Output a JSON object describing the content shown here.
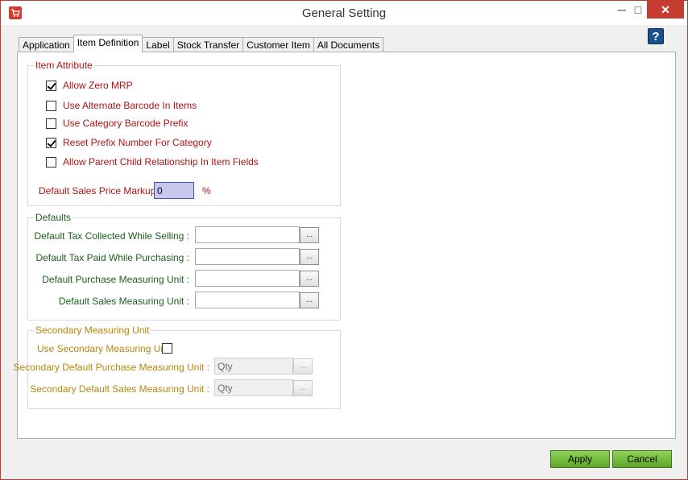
{
  "window": {
    "title": "General Setting",
    "minimize_glyph": "─",
    "maximize_glyph": "□",
    "close_glyph": "✕",
    "help_glyph": "?"
  },
  "tabs": [
    {
      "label": "Application"
    },
    {
      "label": "Item Definition",
      "active": true
    },
    {
      "label": "Label"
    },
    {
      "label": "Stock Transfer"
    },
    {
      "label": "Customer Item"
    },
    {
      "label": "All Documents"
    }
  ],
  "item_attribute": {
    "legend": "Item Attribute",
    "allow_zero_mrp": {
      "label": "Allow Zero MRP",
      "checked": true
    },
    "use_alternate_barcode": {
      "label": "Use Alternate Barcode In Items",
      "checked": false
    },
    "use_category_barcode_prefix": {
      "label": "Use Category Barcode Prefix",
      "checked": false
    },
    "reset_prefix_number": {
      "label": "Reset Prefix Number For Category",
      "checked": true
    },
    "allow_parent_child": {
      "label": "Allow Parent Child Relationship In Item Fields",
      "checked": false
    },
    "markup_label": "Default Sales Price Markup :",
    "markup_value": "0",
    "markup_unit": "%"
  },
  "defaults": {
    "legend": "Defaults",
    "tax_collected_label": "Default Tax Collected  While Selling :",
    "tax_paid_label": "Default Tax Paid While Purchasing :",
    "purchase_unit_label": "Default Purchase Measuring Unit :",
    "sales_unit_label": "Default Sales Measuring Unit :",
    "tax_collected_value": "",
    "tax_paid_value": "",
    "purchase_unit_value": "",
    "sales_unit_value": "",
    "browse_label": "..."
  },
  "secondary": {
    "legend": "Secondary Measuring Unit",
    "use_label": "Use Secondary Measuring Unit",
    "use_checked": false,
    "purchase_label": "Secondary Default Purchase Measuring Unit :",
    "sales_label": "Secondary Default Sales Measuring Unit :",
    "purchase_value": "Qty",
    "sales_value": "Qty",
    "browse_label": "..."
  },
  "buttons": {
    "apply": "Apply",
    "cancel": "Cancel"
  },
  "colors": {
    "item_attribute_text": "#b01313",
    "defaults_text": "#1d5e1d",
    "secondary_text": "#b8860b",
    "button_green": "#6cb83a"
  }
}
